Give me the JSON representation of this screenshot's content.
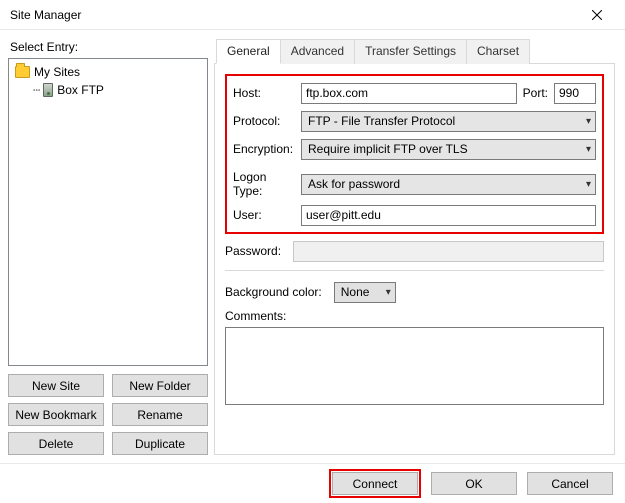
{
  "window": {
    "title": "Site Manager"
  },
  "left": {
    "label": "Select Entry:",
    "root": "My Sites",
    "child": "Box FTP",
    "buttons": {
      "new_site": "New Site",
      "new_folder": "New Folder",
      "new_bookmark": "New Bookmark",
      "rename": "Rename",
      "delete": "Delete",
      "duplicate": "Duplicate"
    }
  },
  "tabs": {
    "general": "General",
    "advanced": "Advanced",
    "transfer": "Transfer Settings",
    "charset": "Charset"
  },
  "general": {
    "host_label": "Host:",
    "host_value": "ftp.box.com",
    "port_label": "Port:",
    "port_value": "990",
    "protocol_label": "Protocol:",
    "protocol_value": "FTP - File Transfer Protocol",
    "encryption_label": "Encryption:",
    "encryption_value": "Require implicit FTP over TLS",
    "logon_label": "Logon Type:",
    "logon_value": "Ask for password",
    "user_label": "User:",
    "user_value": "user@pitt.edu",
    "password_label": "Password:",
    "password_value": "",
    "bgcolor_label": "Background color:",
    "bgcolor_value": "None",
    "comments_label": "Comments:",
    "comments_value": ""
  },
  "footer": {
    "connect": "Connect",
    "ok": "OK",
    "cancel": "Cancel"
  }
}
